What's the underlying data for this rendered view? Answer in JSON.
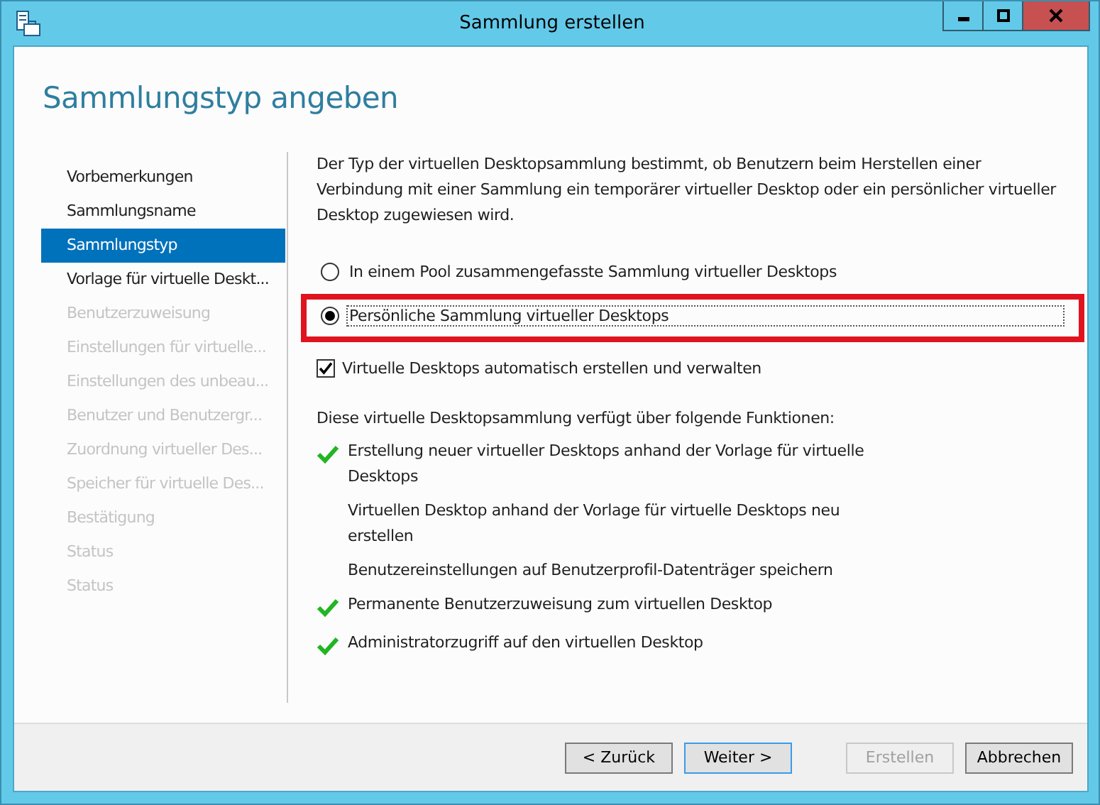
{
  "window": {
    "title": "Sammlung erstellen"
  },
  "heading": "Sammlungstyp angeben",
  "sidebar": {
    "items": [
      {
        "label": "Vorbemerkungen",
        "selected": false,
        "disabled": false
      },
      {
        "label": "Sammlungsname",
        "selected": false,
        "disabled": false
      },
      {
        "label": "Sammlungstyp",
        "selected": true,
        "disabled": false
      },
      {
        "label": "Vorlage für virtuelle Deskt...",
        "selected": false,
        "disabled": false
      },
      {
        "label": "Benutzerzuweisung",
        "selected": false,
        "disabled": true
      },
      {
        "label": "Einstellungen für virtuelle...",
        "selected": false,
        "disabled": true
      },
      {
        "label": "Einstellungen des unbeau...",
        "selected": false,
        "disabled": true
      },
      {
        "label": "Benutzer und Benutzergr...",
        "selected": false,
        "disabled": true
      },
      {
        "label": "Zuordnung virtueller Des...",
        "selected": false,
        "disabled": true
      },
      {
        "label": "Speicher für virtuelle Des...",
        "selected": false,
        "disabled": true
      },
      {
        "label": "Bestätigung",
        "selected": false,
        "disabled": true
      },
      {
        "label": "Status",
        "selected": false,
        "disabled": true
      },
      {
        "label": "Status",
        "selected": false,
        "disabled": true
      }
    ]
  },
  "description": "Der Typ der virtuellen Desktopsammlung bestimmt, ob Benutzern beim Herstellen einer Verbindung mit einer Sammlung ein temporärer virtueller Desktop oder ein persönlicher virtueller Desktop zugewiesen wird.",
  "options": [
    {
      "label": "In einem Pool zusammengefasste Sammlung virtueller Desktops",
      "selected": false,
      "highlighted": false
    },
    {
      "label": "Persönliche Sammlung virtueller Desktops",
      "selected": true,
      "highlighted": true
    }
  ],
  "auto_create": {
    "label": "Virtuelle Desktops automatisch erstellen und verwalten",
    "checked": true
  },
  "features_intro": "Diese virtuelle Desktopsammlung verfügt über folgende Funktionen:",
  "features": [
    {
      "label": "Erstellung neuer virtueller Desktops anhand der Vorlage für virtuelle Desktops",
      "checked": true
    },
    {
      "label": "Virtuellen Desktop anhand der Vorlage für virtuelle Desktops neu erstellen",
      "checked": false
    },
    {
      "label": "Benutzereinstellungen auf Benutzerprofil-Datenträger speichern",
      "checked": false
    },
    {
      "label": "Permanente Benutzerzuweisung zum virtuellen Desktop",
      "checked": true
    },
    {
      "label": "Administratorzugriff auf den virtuellen Desktop",
      "checked": true
    }
  ],
  "buttons": [
    {
      "label": "< Zurück",
      "disabled": false,
      "focused": false
    },
    {
      "label": "Weiter >",
      "disabled": false,
      "focused": true
    },
    {
      "label": "Erstellen",
      "disabled": true,
      "focused": false
    },
    {
      "label": "Abbrechen",
      "disabled": false,
      "focused": false
    }
  ]
}
